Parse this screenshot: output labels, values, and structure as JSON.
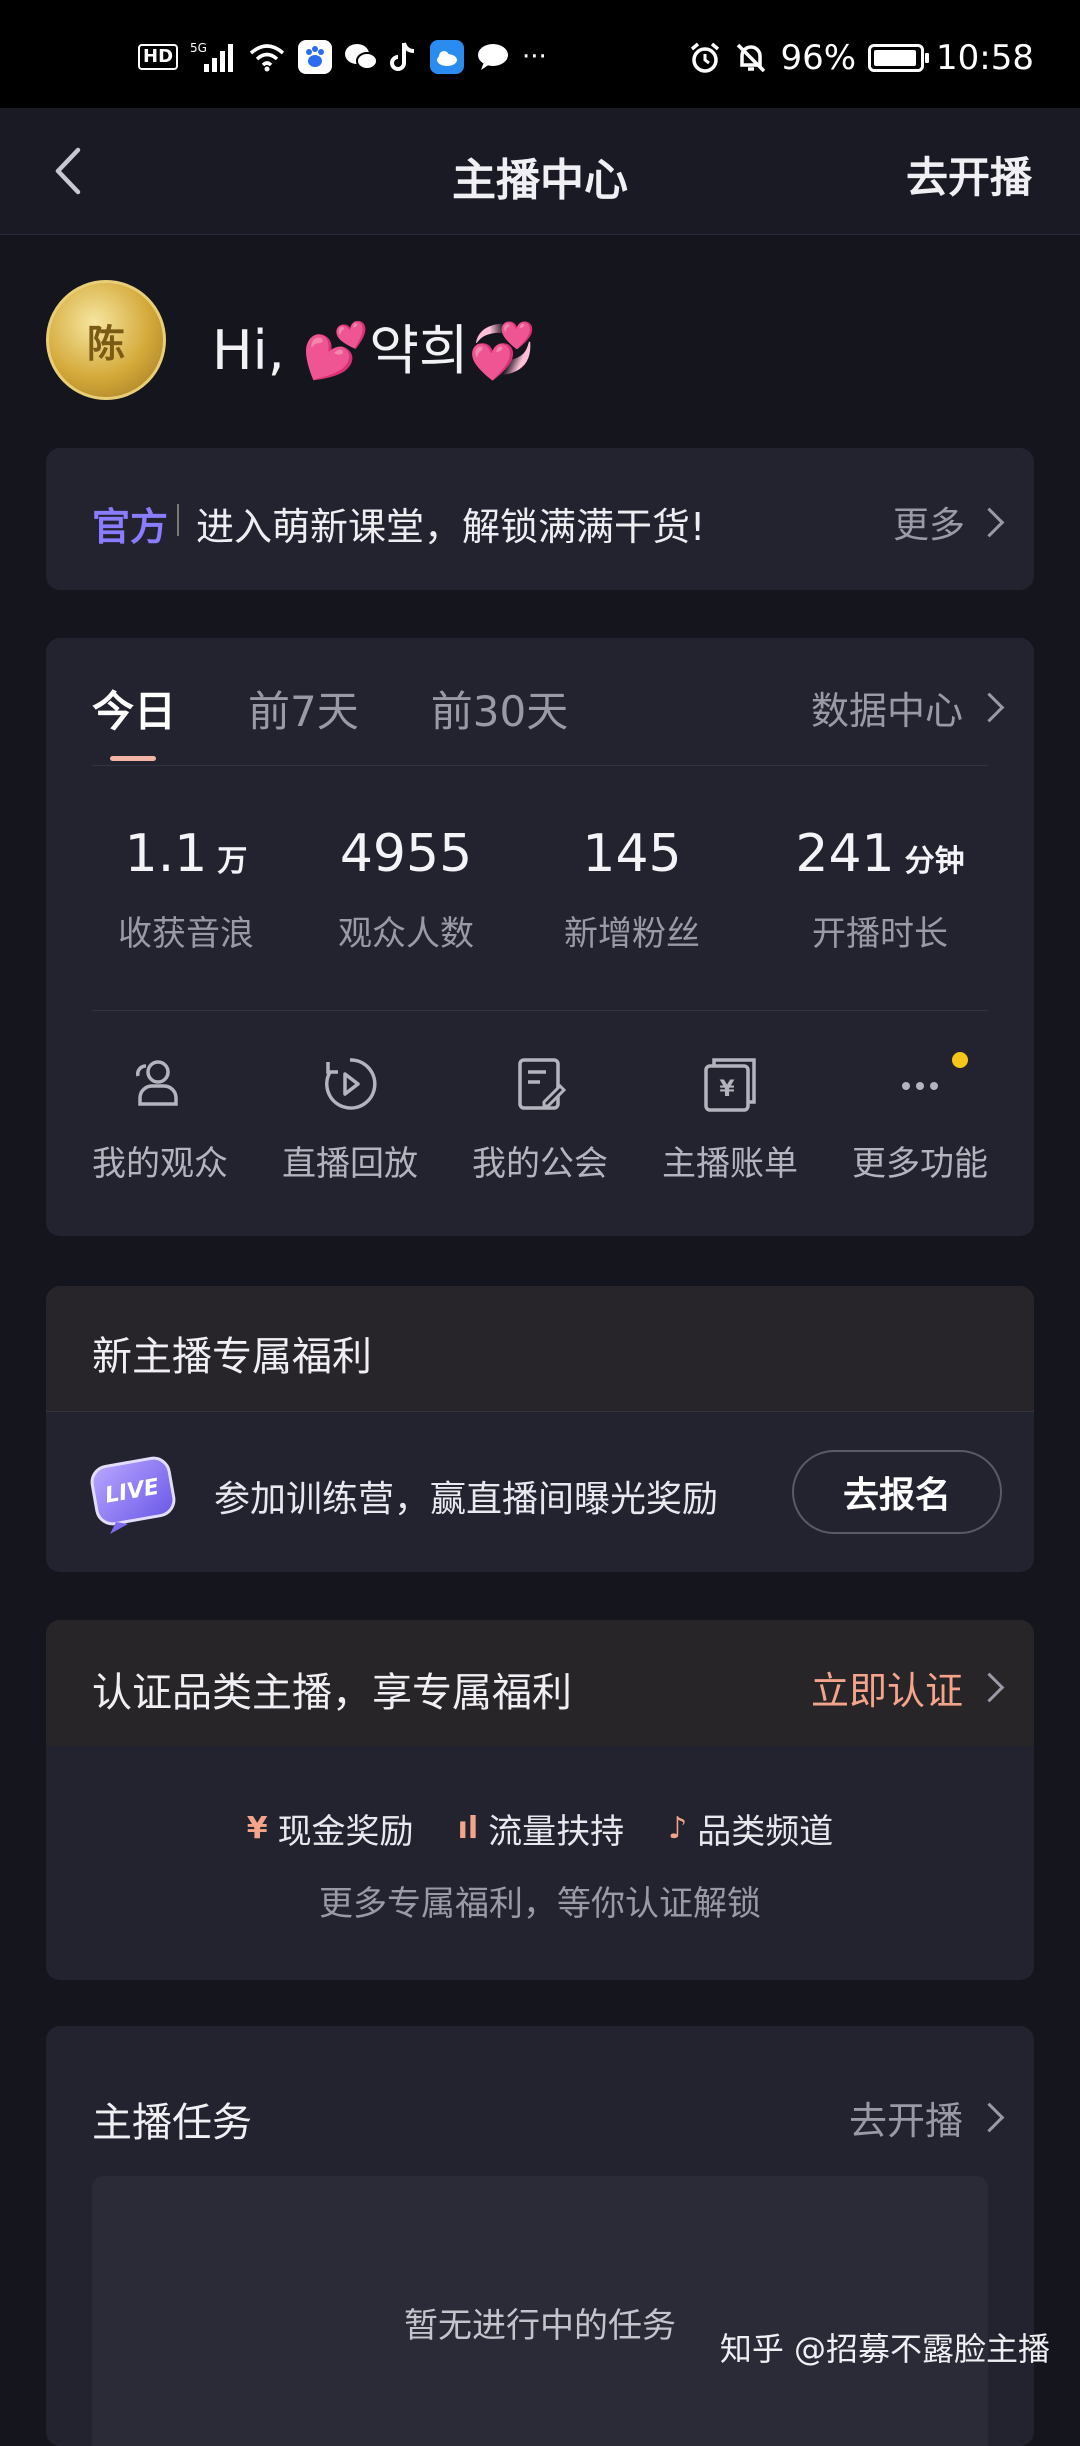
{
  "status_bar": {
    "hd": "HD",
    "network": "5G",
    "battery_level": "96%",
    "battery_fraction": 0.96,
    "time": "10:58",
    "more": "···"
  },
  "nav": {
    "title": "主播中心",
    "action": "去开播"
  },
  "profile": {
    "greeting_prefix": "Hi, ",
    "name": "약희",
    "avatar_text": "陈"
  },
  "notice": {
    "tag": "官方",
    "text": "进入萌新课堂，解锁满满干货!",
    "more": "更多"
  },
  "stats": {
    "tabs": [
      {
        "label": "今日"
      },
      {
        "label": "前7天"
      },
      {
        "label": "前30天"
      }
    ],
    "data_center": "数据中心",
    "metrics": [
      {
        "value": "1.1",
        "unit": "万",
        "label": "收获音浪"
      },
      {
        "value": "4955",
        "unit": "",
        "label": "观众人数"
      },
      {
        "value": "145",
        "unit": "",
        "label": "新增粉丝"
      },
      {
        "value": "241",
        "unit": "分钟",
        "label": "开播时长"
      }
    ],
    "features": [
      {
        "label": "我的观众",
        "icon": "audience-icon"
      },
      {
        "label": "直播回放",
        "icon": "replay-icon"
      },
      {
        "label": "我的公会",
        "icon": "guild-icon"
      },
      {
        "label": "主播账单",
        "icon": "bill-icon"
      },
      {
        "label": "更多功能",
        "icon": "more-icon"
      }
    ]
  },
  "new_benefit": {
    "title": "新主播专属福利",
    "live_badge": "LIVE",
    "text": "参加训练营，赢直播间曝光奖励",
    "button": "去报名"
  },
  "certification": {
    "title": "认证品类主播，享专属福利",
    "action": "立即认证",
    "perks": [
      {
        "icon": "¥",
        "label": "现金奖励"
      },
      {
        "icon": "ıl",
        "label": "流量扶持"
      },
      {
        "icon": "♪",
        "label": "品类频道"
      }
    ],
    "subtitle": "更多专属福利，等你认证解锁"
  },
  "tasks": {
    "title": "主播任务",
    "action": "去开播",
    "empty": "暂无进行中的任务"
  },
  "watermark": "知乎 @招募不露脸主播",
  "colors": {
    "accent_purple": "#8a7cff",
    "accent_peach": "#f4a48a",
    "badge_yellow": "#f5c518"
  }
}
